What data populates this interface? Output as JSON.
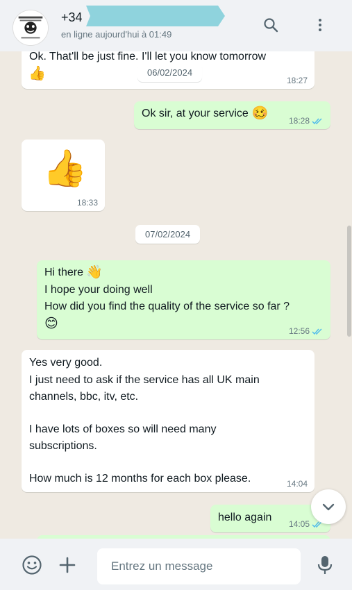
{
  "header": {
    "contact_name": "+34",
    "status": "en ligne aujourd'hui à 01:49",
    "avatar_text_1": "BAD BOY",
    "avatar_text_2": "SERVICE"
  },
  "chat": {
    "m1": {
      "text": "Ok. That'll be just fine. I'll let you know tomorrow",
      "emoji": "👍",
      "time": "18:27"
    },
    "date1": "06/02/2024",
    "m2": {
      "text": "Ok sir, at your service",
      "emoji": "🥴",
      "time": "18:28"
    },
    "m3": {
      "emoji": "👍",
      "time": "18:33"
    },
    "date2": "07/02/2024",
    "m4": {
      "line1": "Hi there",
      "line1_emoji": "👋",
      "line2": "I hope your doing well",
      "line3": "How did you find the quality of the service so far ?",
      "line4_emoji": "😊",
      "time": "12:56"
    },
    "m5": {
      "line1": "Yes very good.",
      "line2": "I just need to ask if the service has all UK main",
      "line3": "channels, bbc, itv, etc.",
      "line4": "I have lots of boxes so will need many",
      "line5": "subscriptions.",
      "line6": "How much is 12 months for each box please.",
      "time": "14:04"
    },
    "m6": {
      "text": "hello again",
      "time": "14:05"
    }
  },
  "footer": {
    "placeholder": "Entrez un message"
  },
  "colors": {
    "outgoing": "#d9fdd3",
    "incoming": "#ffffff",
    "background": "#efeae2",
    "read_ticks": "#53bdeb"
  }
}
